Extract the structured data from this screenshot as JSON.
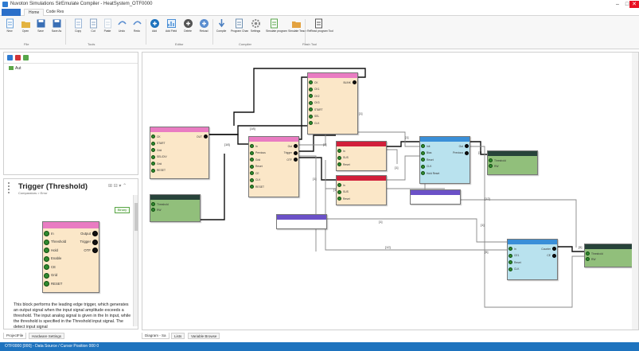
{
  "window": {
    "title": "Nuvoton Simulations SirEmulate Compiler - HeatSystem_OTF0000",
    "controls": [
      "–",
      "□",
      "✕"
    ]
  },
  "ribbon": {
    "file_tab": "",
    "tabs": [
      "Home",
      "Code Res"
    ],
    "buttons": [
      {
        "label": "New",
        "icon": "new-file-icon"
      },
      {
        "label": "Open",
        "icon": "open-folder-icon"
      },
      {
        "label": "Save",
        "icon": "save-icon"
      },
      {
        "label": "Save As",
        "icon": "save-as-icon"
      },
      {
        "label": "Copy",
        "icon": "copy-icon"
      },
      {
        "label": "Cut",
        "icon": "cut-icon"
      },
      {
        "label": "Paste",
        "icon": "paste-icon"
      },
      {
        "label": "Undo",
        "icon": "undo-icon"
      },
      {
        "label": "Redo",
        "icon": "redo-icon"
      },
      {
        "label": "Add",
        "icon": "add-icon"
      },
      {
        "label": "Add Field",
        "icon": "chart-icon"
      },
      {
        "label": "Delete",
        "icon": "delete-icon"
      },
      {
        "label": "Reload",
        "icon": "reload-icon"
      },
      {
        "label": "Compile",
        "icon": "compile-icon"
      },
      {
        "label": "Program Chan",
        "icon": "program-icon"
      },
      {
        "label": "Settings",
        "icon": "settings-icon"
      },
      {
        "label": "Simulate program",
        "icon": "simulate-icon"
      },
      {
        "label": "Simulate Teach Re",
        "icon": "teach-icon"
      },
      {
        "label": "Read program Tool",
        "icon": "read-icon"
      }
    ],
    "groups": [
      "File",
      "Tools",
      "Editor",
      "Compiler",
      "Flash Tool"
    ]
  },
  "project": {
    "tree_item": "Aut"
  },
  "help": {
    "title": "Trigger (Threshold)",
    "subtitle": "Comparators > Error",
    "badge": "Binary",
    "description": "This block performs the leading edge trigger, which generates an output signal when the input signal amplitude exceeds a threshold. The input analog signal is given in the In input, while the threshold is specified in the Threshold input signal. The detect input signal",
    "block": {
      "inputs": [
        "In",
        "Threshold",
        "Hold",
        "Enable",
        "CE",
        "Grid",
        "RESET"
      ],
      "outputs": [
        "Output",
        "Trigger",
        "OTF"
      ]
    }
  },
  "tabs": {
    "left": [
      "ProjectFile",
      "Hardware Settings"
    ],
    "canvas": [
      "Diagram - Sa",
      "Lists",
      "Variable Browse"
    ]
  },
  "status": {
    "text": "OTF0000 [000] - Data Source / Cursor Position 000 0"
  },
  "canvas": {
    "blocks": [
      {
        "id": "b1",
        "head": "",
        "inputs": [
          "CK",
          "START",
          "Grid",
          "SEL/DIV",
          "Grid",
          "RESET"
        ],
        "outputs": [
          "OUT"
        ]
      },
      {
        "id": "b2",
        "head": "",
        "inputs": [
          "In",
          "Previous",
          "Grid",
          "Reset",
          "CE",
          "CLK",
          "RESET"
        ],
        "outputs": [
          "Out",
          "Trigger",
          "OTF"
        ]
      },
      {
        "id": "b3",
        "head": "",
        "inputs": [
          "CK",
          "CK1",
          "CK2",
          "CK3",
          "START",
          "SEL",
          "CLK"
        ],
        "outputs": [
          "BLINK"
        ]
      },
      {
        "id": "b4",
        "head": "",
        "inputs": [
          "In",
          "SUS",
          "Reset"
        ],
        "outputs": []
      },
      {
        "id": "b5",
        "head": "",
        "inputs": [
          "In",
          "SUS",
          "Reset"
        ],
        "outputs": []
      },
      {
        "id": "b6",
        "head": "",
        "inputs": [
          "Init",
          "Bias",
          "Reset",
          "CLK",
          "Hold Reset"
        ],
        "outputs": [
          "Out",
          "Previous"
        ]
      },
      {
        "id": "b7",
        "head": "",
        "inputs": [
          "Threshold",
          "RW"
        ],
        "outputs": []
      },
      {
        "id": "b8",
        "head": "",
        "inputs": [
          "Threshold",
          "RW"
        ],
        "outputs": []
      },
      {
        "id": "b9",
        "head": "",
        "inputs": [
          "In",
          "CE1",
          "Reset",
          "CLK"
        ],
        "outputs": [
          "Counter",
          "CE"
        ]
      },
      {
        "id": "b10",
        "head": "",
        "inputs": [
          "Threshold",
          "RW"
        ],
        "outputs": []
      },
      {
        "id": "b11",
        "head": "",
        "inputs": [],
        "outputs": []
      },
      {
        "id": "b12",
        "head": "",
        "inputs": [],
        "outputs": []
      }
    ],
    "wire_labels": [
      "[18]",
      "[18]",
      "[1]",
      "[1]",
      "[1]",
      "[1]",
      "[1]",
      "[1]",
      "[1]",
      "[1]",
      "[1]",
      "[1]",
      "[12]",
      "[12]",
      "[5]",
      "[5]"
    ]
  },
  "colors": {
    "accent": "#1e73be",
    "pink_head": "#e97cc2",
    "red_head": "#d11f3a",
    "blue_head": "#3a8fd8",
    "purple_head": "#6b51c7",
    "dark_head": "#27433a",
    "yellow_body": "#fbe7c8",
    "cyan_body": "#b9e2ee",
    "green_body": "#91bf7b"
  }
}
